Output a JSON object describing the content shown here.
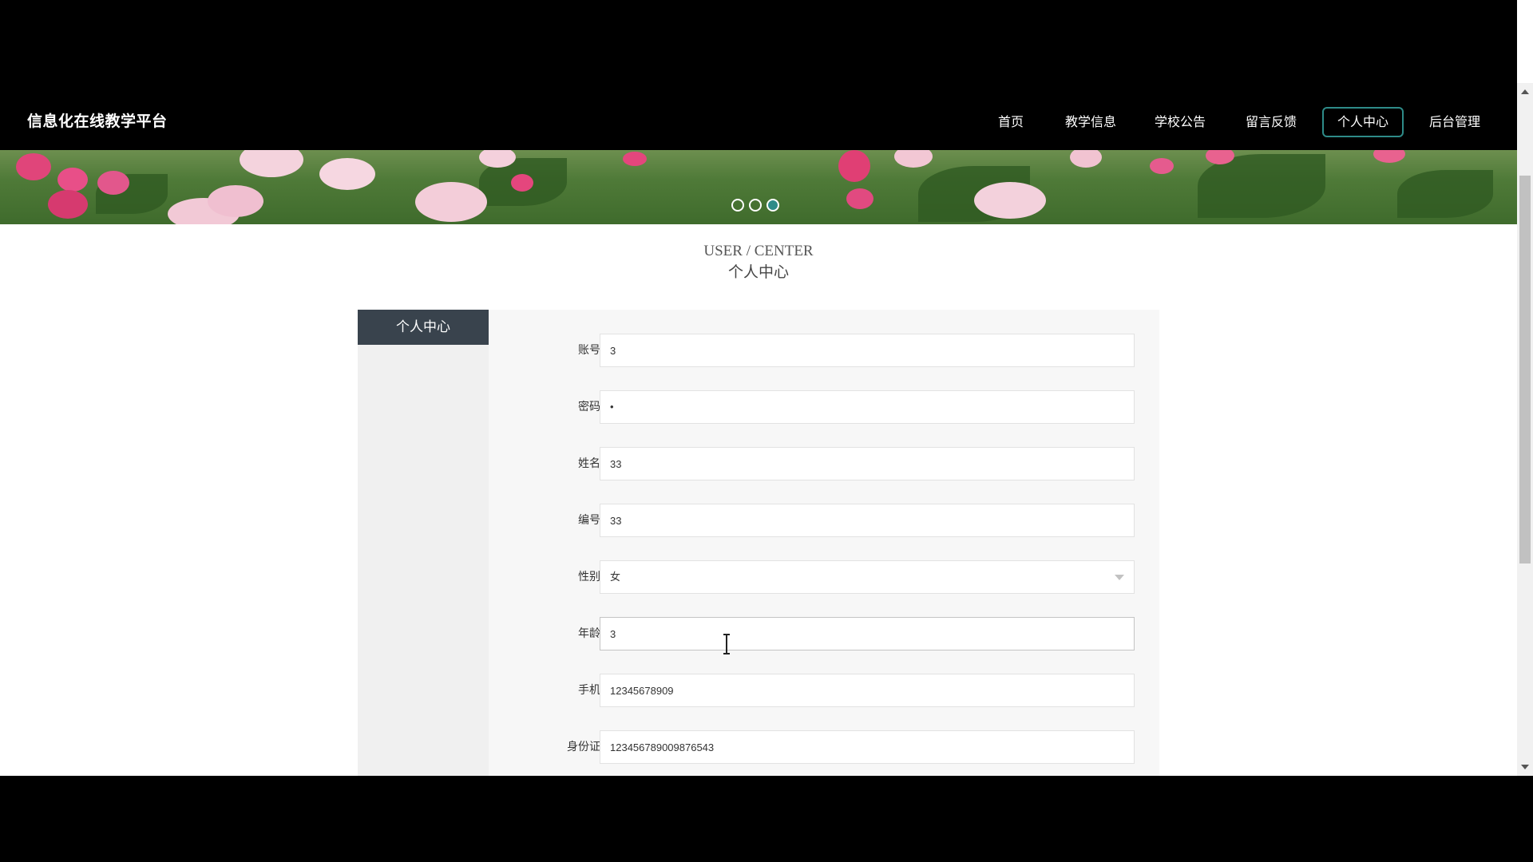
{
  "site": {
    "title": "信息化在线教学平台"
  },
  "nav": {
    "items": [
      {
        "label": "首页"
      },
      {
        "label": "教学信息"
      },
      {
        "label": "学校公告"
      },
      {
        "label": "留言反馈"
      },
      {
        "label": "个人中心",
        "active": true
      },
      {
        "label": "后台管理"
      }
    ]
  },
  "banner": {
    "slide_count": 3,
    "active_slide": 3
  },
  "section": {
    "title_en": "USER / CENTER",
    "title_cn": "个人中心"
  },
  "sidebar": {
    "header": "个人中心"
  },
  "form": {
    "fields": [
      {
        "label": "账号",
        "value": "3",
        "type": "text"
      },
      {
        "label": "密码",
        "value": "•",
        "type": "password"
      },
      {
        "label": "姓名",
        "value": "33",
        "type": "text"
      },
      {
        "label": "编号",
        "value": "33",
        "type": "text"
      },
      {
        "label": "性别",
        "value": "女",
        "type": "select"
      },
      {
        "label": "年龄",
        "value": "3",
        "type": "text",
        "focused": true
      },
      {
        "label": "手机",
        "value": "12345678909",
        "type": "text"
      },
      {
        "label": "身份证",
        "value": "123456789009876543",
        "type": "text"
      }
    ]
  },
  "colors": {
    "accent": "#2e8b88",
    "sidebar_header_bg": "#39434d",
    "navbar_bg": "#000000"
  }
}
